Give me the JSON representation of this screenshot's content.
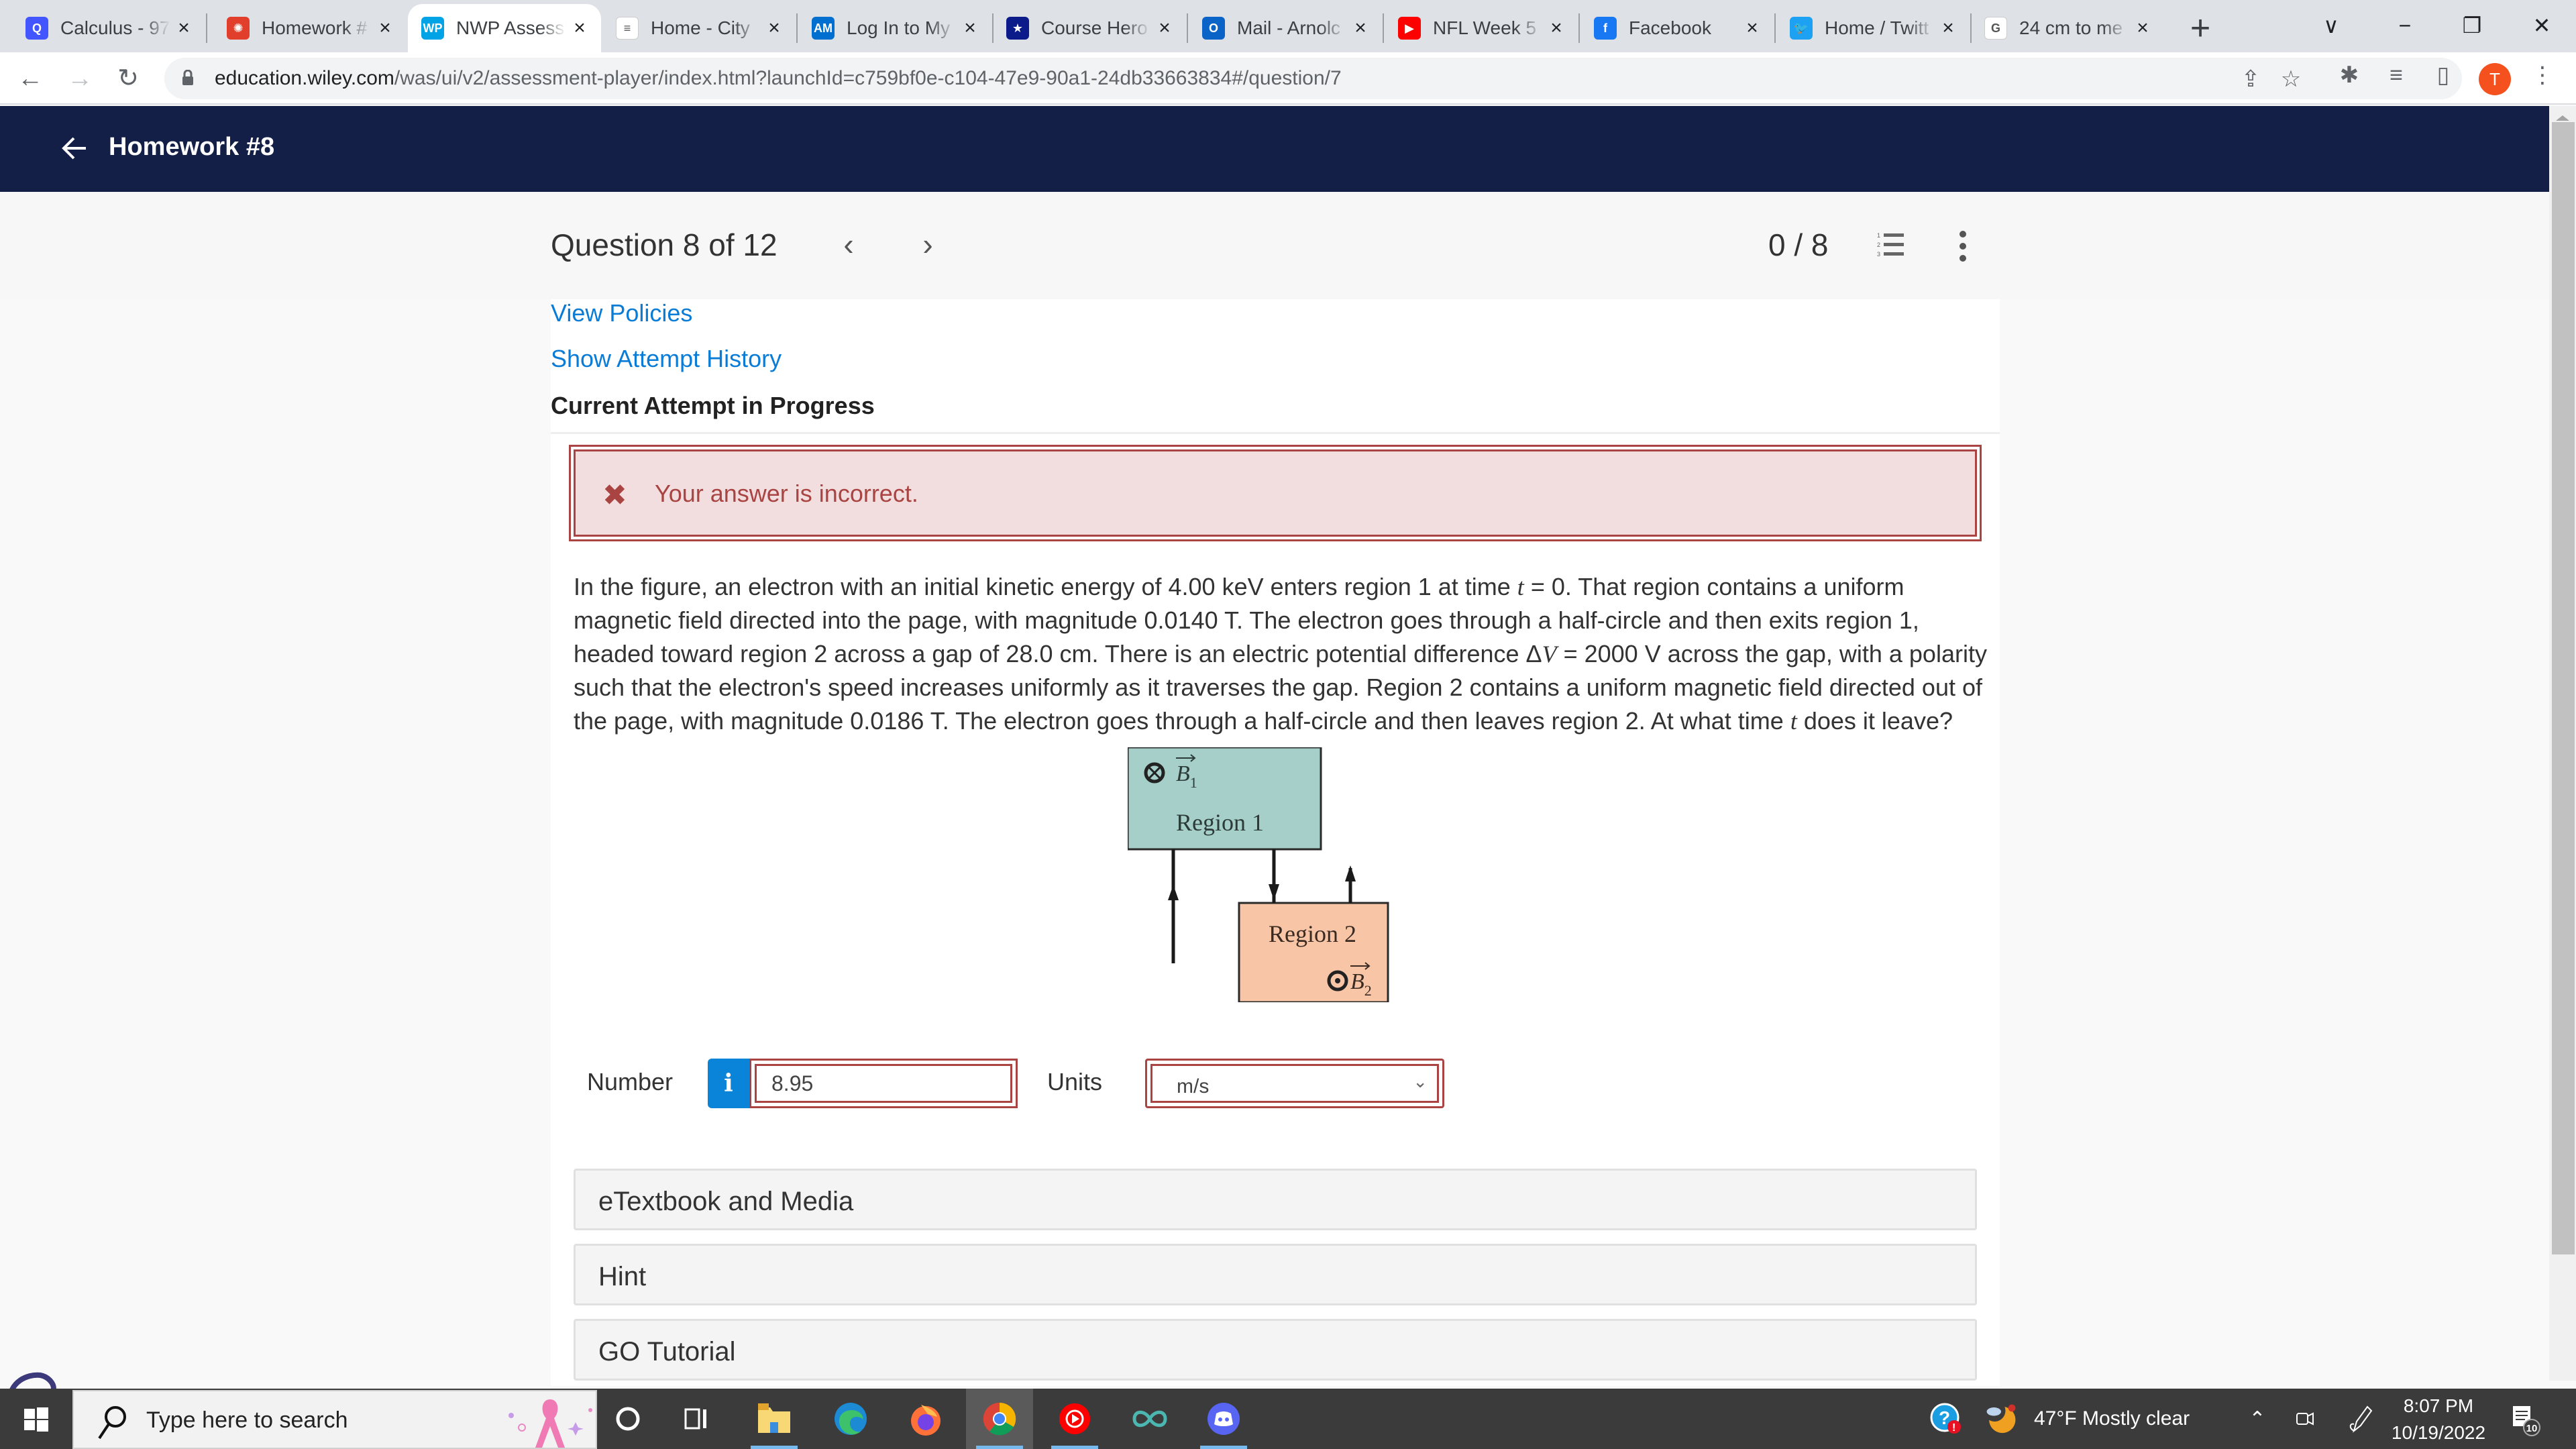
{
  "browser": {
    "tabs": [
      {
        "title": "Calculus - 97",
        "icon": "quizlet-icon",
        "color": "#4255ff",
        "glyph": "Q"
      },
      {
        "title": "Homework #",
        "icon": "canvas-icon",
        "color": "#e13f2b",
        "glyph": "✺"
      },
      {
        "title": "NWP Assessi",
        "icon": "wp-icon",
        "color": "#00a3e6",
        "glyph": "WP",
        "active": true
      },
      {
        "title": "Home - City",
        "icon": "cityu-icon",
        "color": "#ffffff",
        "glyph": "≡"
      },
      {
        "title": "Log In to My",
        "icon": "amex-icon",
        "color": "#016fd0",
        "glyph": "AM"
      },
      {
        "title": "Course Hero",
        "icon": "coursehero-icon",
        "color": "#0c1b8a",
        "glyph": "★"
      },
      {
        "title": "Mail - Arnolc",
        "icon": "outlook-icon",
        "color": "#0a64c8",
        "glyph": "O"
      },
      {
        "title": "NFL Week 5",
        "icon": "youtube-icon",
        "color": "#ff0000",
        "glyph": "▶"
      },
      {
        "title": "Facebook",
        "icon": "facebook-icon",
        "color": "#1877f2",
        "glyph": "f"
      },
      {
        "title": "Home / Twitt",
        "icon": "twitter-icon",
        "color": "#1da1f2",
        "glyph": "🐦"
      },
      {
        "title": "24 cm to me",
        "icon": "google-icon",
        "color": "#ffffff",
        "glyph": "G"
      }
    ],
    "new_tab": "+",
    "window_controls": {
      "tab_search": "∨",
      "minimize": "−",
      "restore": "❐",
      "close": "✕"
    },
    "url_domain": "education.wiley.com",
    "url_path": "/was/ui/v2/assessment-player/index.html?launchId=c759bf0e-c104-47e9-90a1-24db33663834#/question/7",
    "profile_initial": "T",
    "profile_color": "#f4511e"
  },
  "app": {
    "header_title": "Homework #8",
    "question_label": "Question 8 of 12",
    "score": "0 / 8",
    "links": {
      "view_policies": "View Policies",
      "show_attempt_history": "Show Attempt History"
    },
    "attempt_status": "Current Attempt in Progress",
    "feedback": {
      "message": "Your answer is incorrect.",
      "color": "#a94442"
    },
    "question": {
      "p1": "In the figure, an electron with an initial kinetic energy of 4.00 keV enters region 1 at time ",
      "t1": "t",
      "p2": " = 0. That region contains a uniform magnetic field directed into the page, with magnitude 0.0140 T. The electron goes through a half-circle and then exits region 1, headed toward region 2 across a gap of 28.0 cm. There is an electric potential difference Δ",
      "v": "V",
      "p3": " = 2000 V across the gap, with a polarity such that the electron's speed increases uniformly as it traverses the gap. Region 2 contains a uniform magnetic field directed out of the page, with magnitude 0.0186 T. The electron goes through a half-circle and then leaves region 2. At what time ",
      "t2": "t",
      "p4": " does it leave?"
    },
    "figure": {
      "region1_label": "Region 1",
      "region2_label": "Region 2",
      "b1_label": "B",
      "b1_sub": "1",
      "b2_label": "B",
      "b2_sub": "2",
      "region1_color": "#a5cfc8",
      "region2_color": "#f8c6a6"
    },
    "answer": {
      "number_label": "Number",
      "info_glyph": "i",
      "number_value": "8.95",
      "units_label": "Units",
      "units_value": "m/s"
    },
    "resources": [
      {
        "label": "eTextbook and Media"
      },
      {
        "label": "Hint"
      },
      {
        "label": "GO Tutorial"
      }
    ]
  },
  "taskbar": {
    "search_placeholder": "Type here to search",
    "weather": "47°F  Mostly clear",
    "time": "8:07 PM",
    "date": "10/19/2022",
    "notification_count": "10"
  }
}
